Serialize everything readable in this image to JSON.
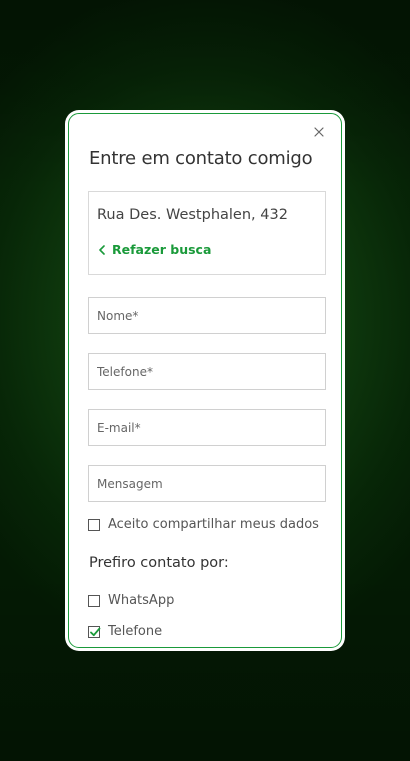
{
  "modal": {
    "title": "Entre em contato comigo",
    "close_icon": "close-icon",
    "address": "Rua Des. Westphalen, 432",
    "redo_search_label": "Refazer busca",
    "accent_color": "#1a9a3a"
  },
  "form": {
    "name_placeholder": "Nome*",
    "phone_placeholder": "Telefone*",
    "email_placeholder": "E-mail*",
    "message_placeholder": "Mensagem",
    "consent_label": "Aceito compartilhar meus dados",
    "consent_checked": false,
    "preference_title": "Prefiro contato por:",
    "preferences": [
      {
        "label": "WhatsApp",
        "checked": false
      },
      {
        "label": "Telefone",
        "checked": true
      }
    ]
  }
}
